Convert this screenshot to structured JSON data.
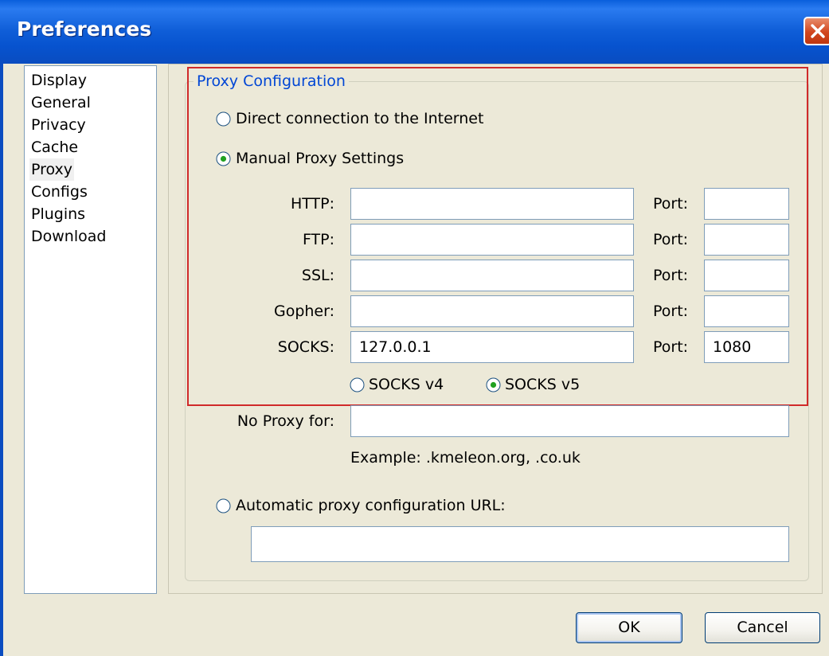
{
  "window": {
    "title": "Preferences"
  },
  "sidebar": {
    "items": [
      {
        "label": "Display"
      },
      {
        "label": "General"
      },
      {
        "label": "Privacy"
      },
      {
        "label": "Cache"
      },
      {
        "label": "Proxy",
        "selected": true
      },
      {
        "label": "Configs"
      },
      {
        "label": "Plugins"
      },
      {
        "label": "Download"
      }
    ]
  },
  "proxy": {
    "group_title": "Proxy Configuration",
    "direct_label": "Direct connection to the Internet",
    "manual_label": "Manual Proxy Settings",
    "selected_mode": "manual",
    "fields": {
      "http": {
        "label": "HTTP:",
        "value": "",
        "port_label": "Port:",
        "port": ""
      },
      "ftp": {
        "label": "FTP:",
        "value": "",
        "port_label": "Port:",
        "port": ""
      },
      "ssl": {
        "label": "SSL:",
        "value": "",
        "port_label": "Port:",
        "port": ""
      },
      "gopher": {
        "label": "Gopher:",
        "value": "",
        "port_label": "Port:",
        "port": ""
      },
      "socks": {
        "label": "SOCKS:",
        "value": "127.0.0.1",
        "port_label": "Port:",
        "port": "1080"
      }
    },
    "socks_v4_label": "SOCKS v4",
    "socks_v5_label": "SOCKS v5",
    "socks_version": "v5",
    "no_proxy": {
      "label": "No Proxy for:",
      "value": "",
      "example": "Example: .kmeleon.org, .co.uk"
    },
    "auto_label": "Automatic proxy configuration URL:",
    "auto_url": ""
  },
  "buttons": {
    "ok": "OK",
    "cancel": "Cancel"
  },
  "colors": {
    "titlebar": "#0A5FDC",
    "group_title": "#0046D5",
    "highlight": "#D02A2A",
    "dialog_bg": "#ECE9D8",
    "radio_dot": "#21A121"
  }
}
